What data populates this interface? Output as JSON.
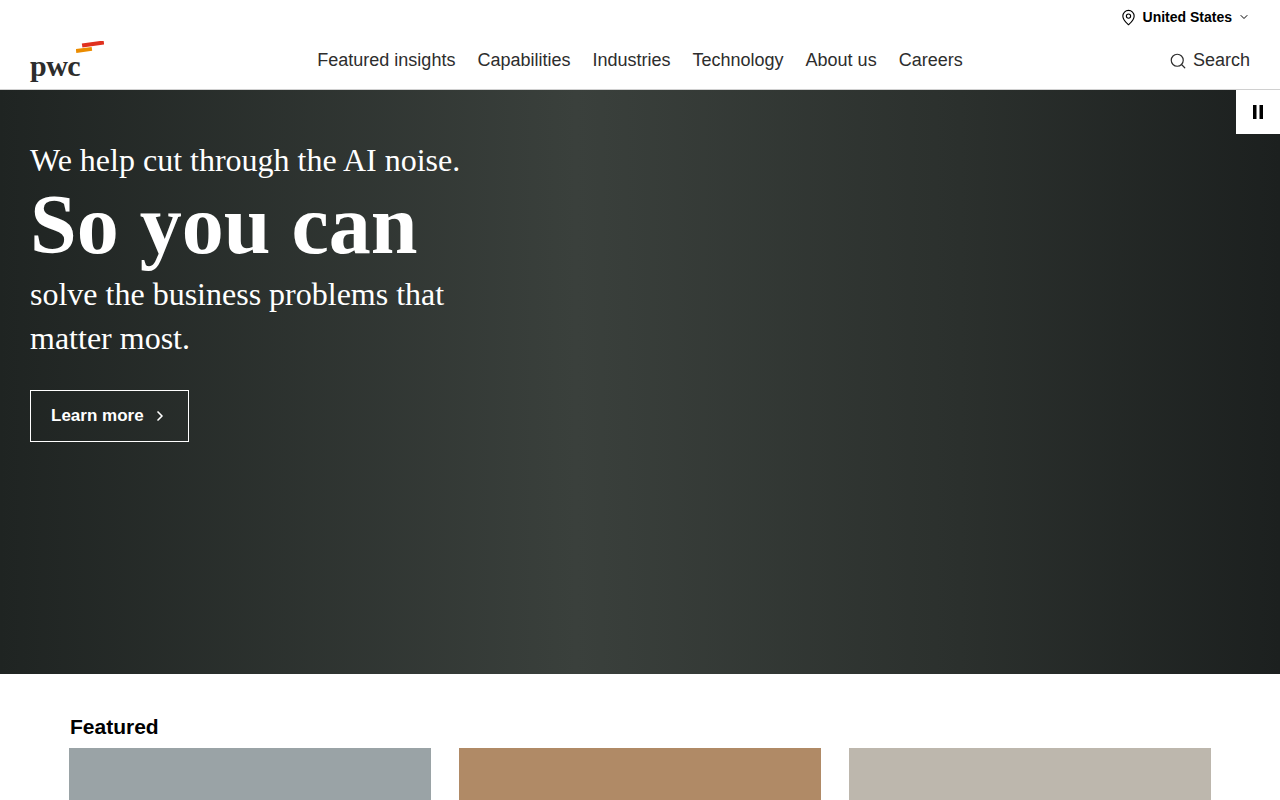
{
  "header": {
    "region": "United States",
    "logo": "pwc",
    "search": "Search"
  },
  "nav": [
    {
      "label": "Featured insights"
    },
    {
      "label": "Capabilities"
    },
    {
      "label": "Industries"
    },
    {
      "label": "Technology"
    },
    {
      "label": "About us"
    },
    {
      "label": "Careers"
    }
  ],
  "hero": {
    "kicker": "We help cut through the AI noise.",
    "headline": "So you can",
    "subline": "solve the business problems that matter most.",
    "button": "Learn more",
    "playing": true
  },
  "featured": {
    "heading": "Featured",
    "cards": [
      {
        "color": "#9aa3a6"
      },
      {
        "color": "#b08a66"
      },
      {
        "color": "#bdb7ad"
      }
    ]
  }
}
